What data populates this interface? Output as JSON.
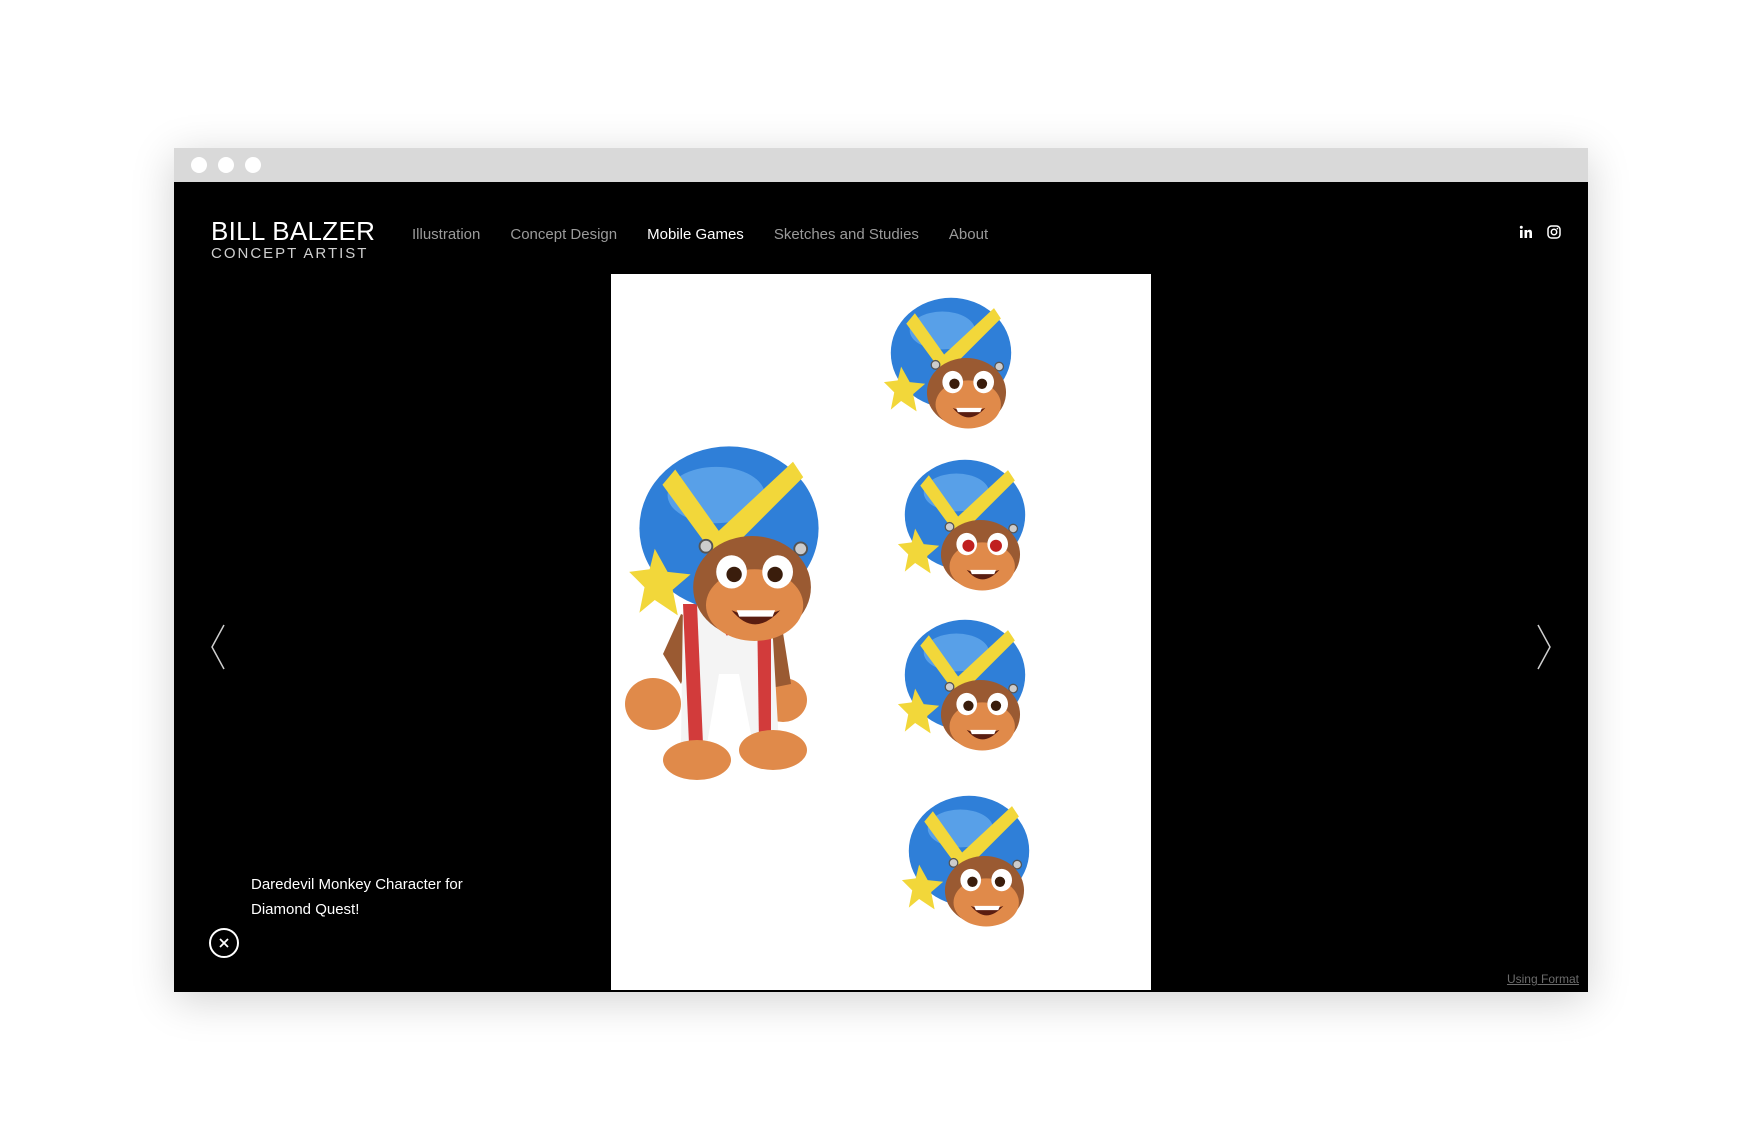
{
  "brand": {
    "name": "BILL BALZER",
    "subtitle": "CONCEPT ARTIST"
  },
  "nav": {
    "items": [
      {
        "label": "Illustration",
        "active": false
      },
      {
        "label": "Concept Design",
        "active": false
      },
      {
        "label": "Mobile Games",
        "active": true
      },
      {
        "label": "Sketches and Studies",
        "active": false
      },
      {
        "label": "About",
        "active": false
      }
    ]
  },
  "social": {
    "icons": [
      "linkedin-icon",
      "instagram-icon"
    ]
  },
  "artwork": {
    "alt_description": "",
    "colors": {
      "helmet": "#2f7fd8",
      "stripe": "#f2d73a",
      "fur": "#e08a4a",
      "suit": "#f4f4f4",
      "suit_stripe": "#d23b3b"
    }
  },
  "caption": {
    "text": "Daredevil Monkey Character for Diamond Quest!"
  },
  "footer": {
    "link": "Using Format"
  },
  "colors": {
    "background": "#000000",
    "nav_text": "#9a9a9a",
    "nav_active": "#ffffff",
    "browser_chrome": "#d9d9d9"
  }
}
